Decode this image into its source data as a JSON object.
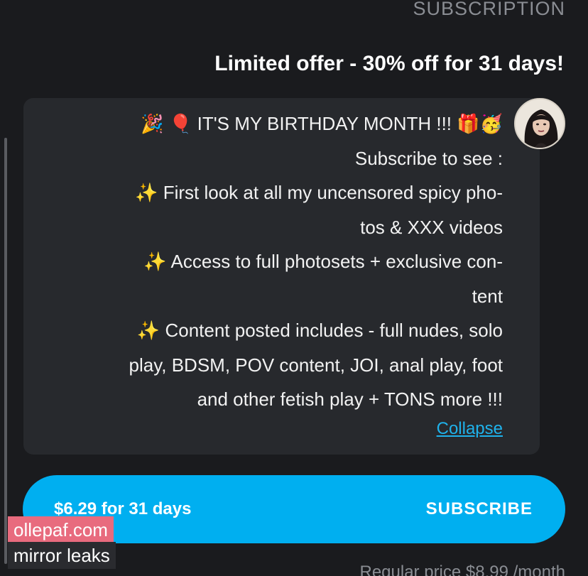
{
  "section": {
    "label": "SUBSCRIPTION"
  },
  "offer": {
    "title": "Limited offer - 30% off for 31 days!"
  },
  "message": {
    "lines": [
      "🎉 🎈 IT'S MY BIRTHDAY MONTH !!! 🎁🥳",
      "Subscribe to see :",
      "✨ First look at all my uncensored spicy pho-",
      "tos & XXX videos",
      "✨ Access to full photosets + exclusive con-",
      "tent",
      "✨ Content posted includes - full nudes, solo",
      "play, BDSM, POV content, JOI, anal play, foot",
      "and other fetish play + TONS more !!!"
    ],
    "collapse_label": "Collapse"
  },
  "subscribe_button": {
    "label": "SUBSCRIBE",
    "price": "$6.29 for 31 days"
  },
  "regular_price": "Regular price $8.99 /month",
  "watermark": {
    "line1": "ollepaf.com",
    "line2": "mirror leaks"
  },
  "colors": {
    "background": "#1a1b1e",
    "bubble": "#27292d",
    "accent": "#00aff0",
    "link": "#1fb2eb",
    "muted": "#8a8d93"
  },
  "icons": [
    "party-popper-icon",
    "balloon-icon",
    "gift-icon",
    "partying-face-icon",
    "sparkles-icon"
  ]
}
